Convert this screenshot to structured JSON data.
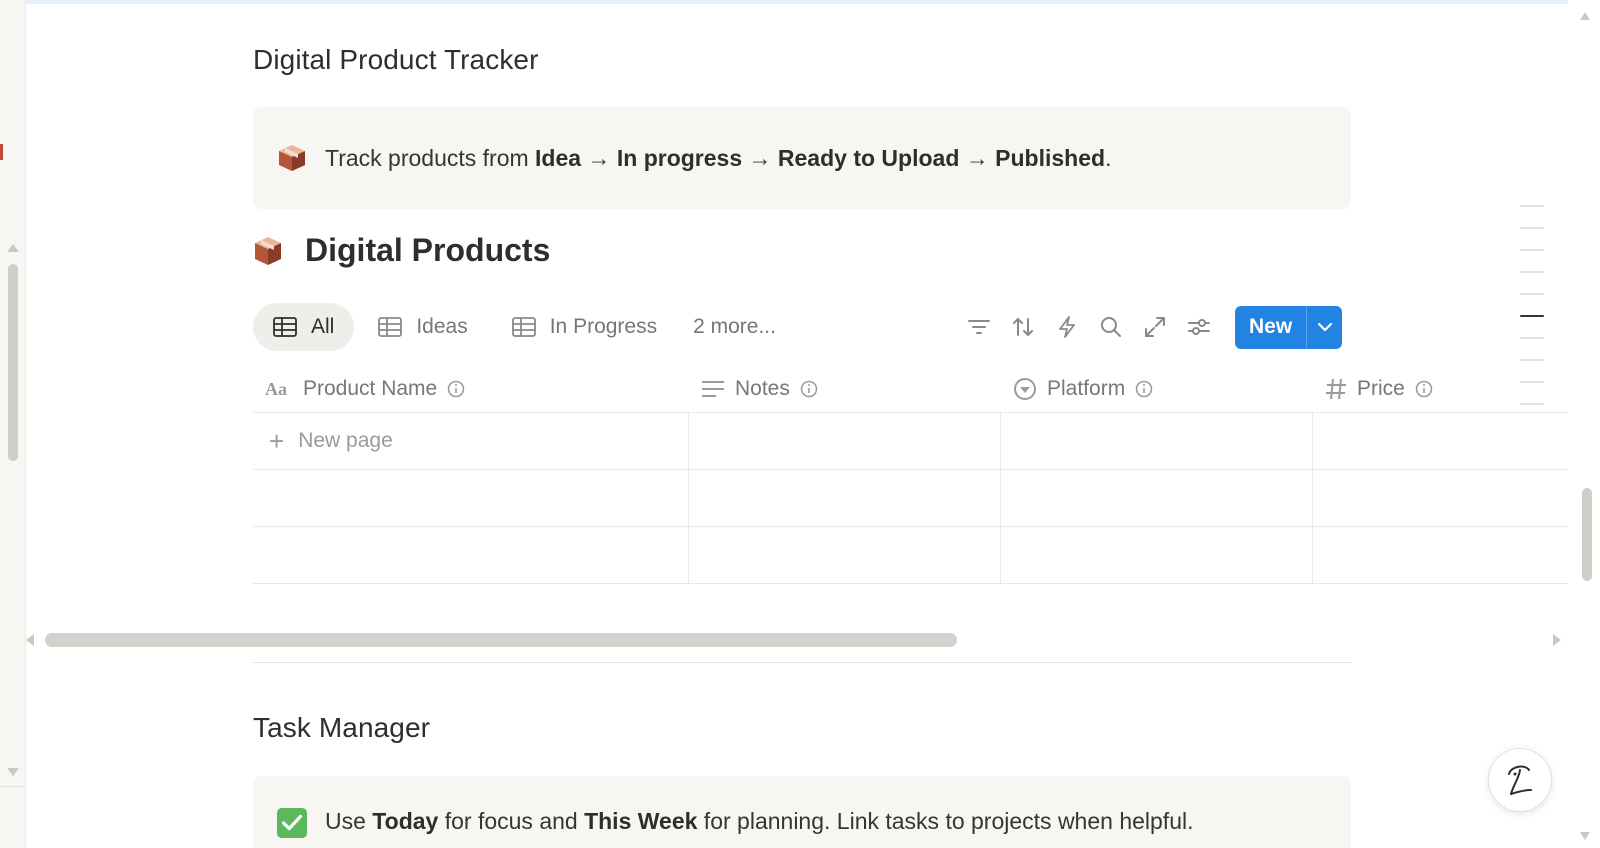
{
  "sections": [
    {
      "title": "Digital Product Tracker",
      "callout": {
        "icon": "package-icon",
        "parts": [
          {
            "text": "Track products from ",
            "bold": false
          },
          {
            "text": "Idea",
            "bold": true
          },
          {
            "text": " → ",
            "bold": false
          },
          {
            "text": "In progress",
            "bold": true
          },
          {
            "text": " → ",
            "bold": false
          },
          {
            "text": "Ready to Upload",
            "bold": true
          },
          {
            "text": " → ",
            "bold": false
          },
          {
            "text": "Published",
            "bold": true
          },
          {
            "text": ".",
            "bold": false
          }
        ]
      }
    },
    {
      "title": "Task Manager",
      "callout": {
        "icon": "check-mark-icon",
        "parts": [
          {
            "text": "Use ",
            "bold": false
          },
          {
            "text": "Today",
            "bold": true
          },
          {
            "text": " for focus and ",
            "bold": false
          },
          {
            "text": "This Week",
            "bold": true
          },
          {
            "text": " for planning. Link tasks to projects when helpful.",
            "bold": false
          }
        ]
      }
    }
  ],
  "database": {
    "title": "Digital Products",
    "icon": "package-icon",
    "views": [
      {
        "label": "All",
        "active": true
      },
      {
        "label": "Ideas",
        "active": false
      },
      {
        "label": "In Progress",
        "active": false
      }
    ],
    "more_views": "2 more...",
    "toolbar": {
      "icons": [
        "filter-icon",
        "sort-icon",
        "automation-icon",
        "search-icon",
        "expand-icon",
        "settings-icon"
      ],
      "new_label": "New"
    },
    "columns": [
      {
        "label": "Product Name",
        "icon": "title-icon"
      },
      {
        "label": "Notes",
        "icon": "text-lines-icon"
      },
      {
        "label": "Platform",
        "icon": "select-icon"
      },
      {
        "label": "Price",
        "icon": "number-icon"
      }
    ],
    "new_page_label": "New page",
    "empty_rows": 2
  },
  "colors": {
    "accent": "#2383e2",
    "callout_bg": "#f7f6f3",
    "text": "#37352f",
    "muted": "#787774"
  }
}
